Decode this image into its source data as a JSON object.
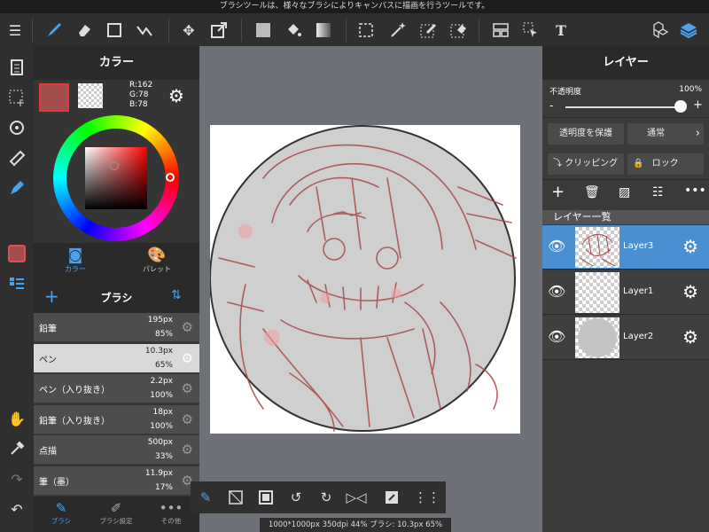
{
  "info_text": "ブラシツールは、様々なブラシによりキャンバスに描画を行うツールです。",
  "colors": {
    "primary": "#a24e4e",
    "accent": "#4a8fd0"
  },
  "color_panel": {
    "title": "カラー",
    "rgb_r": "R:162",
    "rgb_g": "G:78",
    "rgb_b": "B:78",
    "tab_color": "カラー",
    "tab_palette": "パレット"
  },
  "brush_panel": {
    "title": "ブラシ",
    "brushes": [
      {
        "name": "鉛筆",
        "size": "195px",
        "opacity": "85%"
      },
      {
        "name": "ペン",
        "size": "10.3px",
        "opacity": "65%"
      },
      {
        "name": "ペン（入り抜き）",
        "size": "2.2px",
        "opacity": "100%"
      },
      {
        "name": "鉛筆（入り抜き）",
        "size": "18px",
        "opacity": "100%"
      },
      {
        "name": "点描",
        "size": "500px",
        "opacity": "33%"
      },
      {
        "name": "筆（墨）",
        "size": "11.9px",
        "opacity": "17%"
      }
    ],
    "tab_brush": "ブラシ",
    "tab_brush_settings": "ブラシ設定",
    "tab_other": "その他"
  },
  "layer_panel": {
    "title": "レイヤー",
    "opacity_label": "不透明度",
    "opacity_value": "100%",
    "opacity": 1.0,
    "protect_alpha": "透明度を保護",
    "blend_mode": "通常",
    "clipping": "クリッピング",
    "lock": "ロック",
    "list_title": "レイヤー一覧",
    "layers": [
      {
        "name": "Layer3"
      },
      {
        "name": "Layer1"
      },
      {
        "name": "Layer2"
      }
    ]
  },
  "status": "1000*1000px 350dpi 44% ブラシ: 10.3px 65%"
}
